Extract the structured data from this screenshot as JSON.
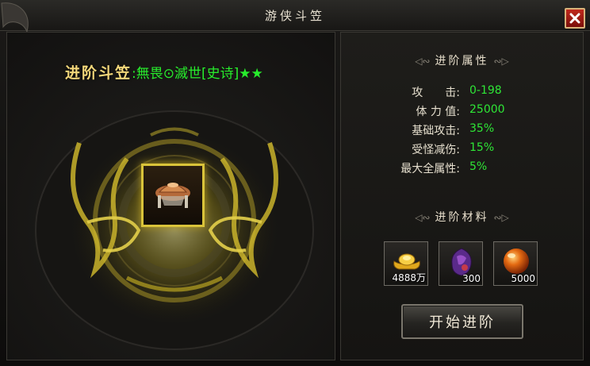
{
  "window": {
    "title": "游侠斗笠"
  },
  "item": {
    "label": "进阶斗笠",
    "name": ":無畏⊙滅世[史诗]★★"
  },
  "attributes": {
    "header": "进阶属性",
    "rows": [
      {
        "label": "攻　　击:",
        "value": "0-198"
      },
      {
        "label": "体 力 值:",
        "value": "25000"
      },
      {
        "label": "基础攻击:",
        "value": "35%"
      },
      {
        "label": "受怪减伤:",
        "value": "15%"
      },
      {
        "label": "最大全属性:",
        "value": "5%"
      }
    ]
  },
  "materials": {
    "header": "进阶材料",
    "items": [
      {
        "icon": "gold-ingot-icon",
        "count": "4888万"
      },
      {
        "icon": "purple-gem-icon",
        "count": "300"
      },
      {
        "icon": "orange-orb-icon",
        "count": "5000"
      }
    ]
  },
  "action": {
    "start_label": "开始进阶"
  },
  "colors": {
    "value_green": "#2ee636",
    "title_gold": "#f3d77a",
    "close_red": "#b3231a"
  }
}
